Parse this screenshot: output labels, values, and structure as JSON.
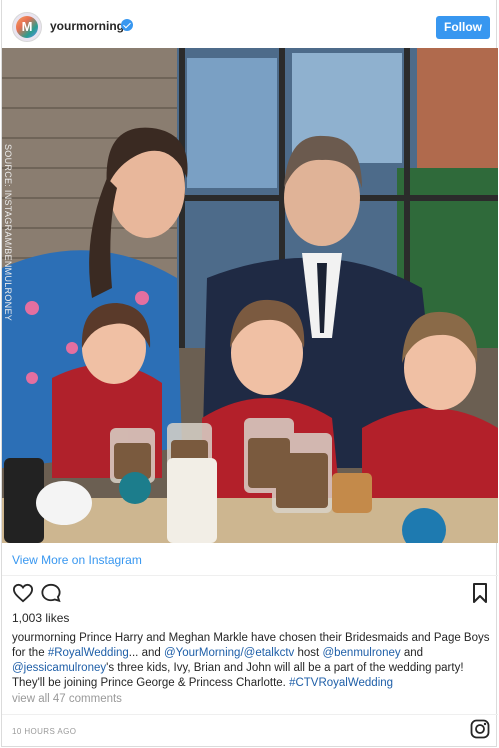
{
  "post": {
    "username": "yourmorning",
    "follow_label": "Follow",
    "watermark": "SOURCE: INSTAGRAM/BENMULRONEY",
    "view_more": "View More on Instagram",
    "likes": "1,003 likes",
    "caption": {
      "user": "yourmorning",
      "t1": " Prince Harry and Meghan Markle have chosen their Bridesmaids and Page Boys for the ",
      "tag1": "#RoyalWedding",
      "t2": "... and ",
      "mention1": "@YourMorning",
      "t3": "/",
      "mention2": "@etalkctv",
      "t4": " host ",
      "mention3": "@benmulroney",
      "t5": " and ",
      "mention4": "@jessicamulroney",
      "t6": "'s three kids, Ivy, Brian and John will all be a part of the wedding party! They'll be joining Prince George & Princess Charlotte. ",
      "tag2": "#CTVRoyalWedding"
    },
    "comments": "view all 47 comments",
    "timestamp": "10 HOURS AGO"
  },
  "icons": {
    "avatar": "yourmorning-logo",
    "verified": "verified-badge-icon",
    "like": "heart-icon",
    "comment": "comment-icon",
    "save": "bookmark-icon",
    "brand": "instagram-icon"
  },
  "colors": {
    "accent": "#3897f0",
    "link": "#1f5fa8",
    "muted": "#999999"
  }
}
